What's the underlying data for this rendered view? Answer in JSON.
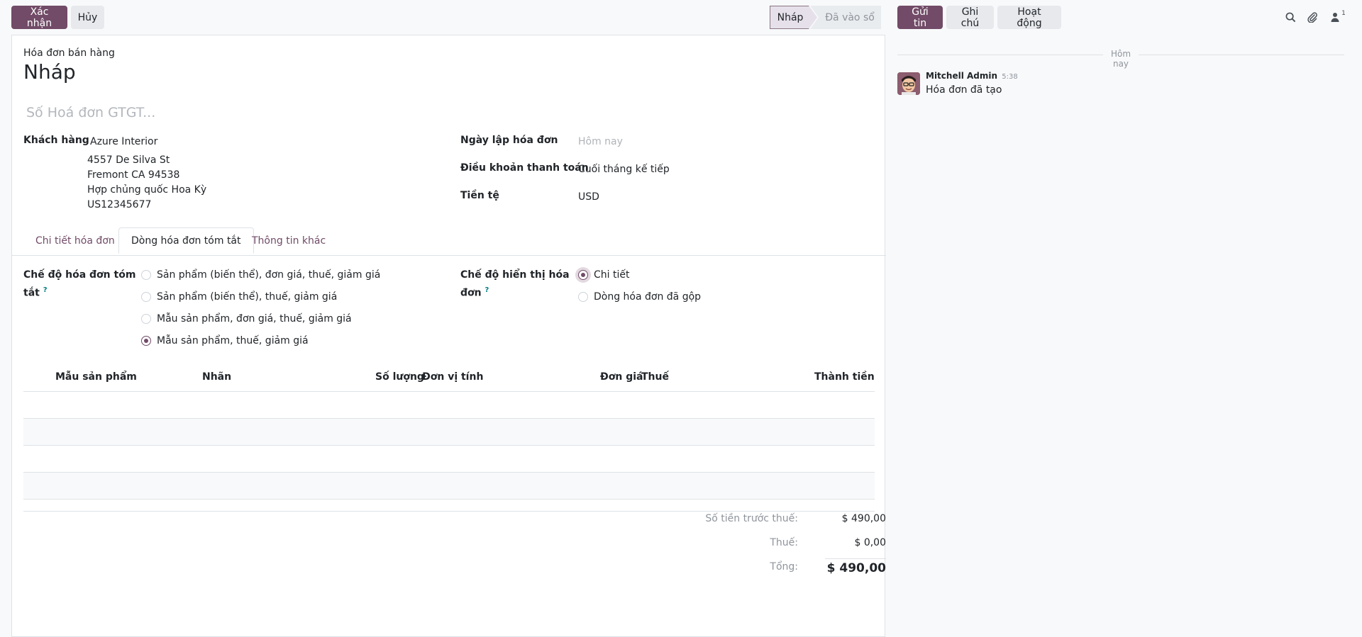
{
  "toolbar": {
    "confirm_label": "Xác nhận",
    "cancel_label": "Hủy"
  },
  "status": {
    "stages": [
      "Nháp",
      "Đã vào sổ"
    ],
    "active": "Nháp"
  },
  "form": {
    "doc_type": "Hóa đơn bán hàng",
    "title": "Nháp",
    "vat_placeholder": "Số Hoá đơn GTGT...",
    "customer_label": "Khách hàng",
    "customer_name": "Azure Interior",
    "address": [
      "4557 De Silva St",
      "Fremont CA 94538",
      "Hợp chủng quốc Hoa Kỳ",
      "US12345677"
    ],
    "invoice_date_label": "Ngày lập hóa đơn",
    "invoice_date_placeholder": "Hôm nay",
    "payment_terms_label": "Điều khoản thanh toán",
    "payment_terms_value": "Cuối tháng kế tiếp",
    "currency_label": "Tiền tệ",
    "currency_value": "USD"
  },
  "tabs": [
    {
      "label": "Chi tiết hóa đơn",
      "active": false
    },
    {
      "label": "Dòng hóa đơn tóm tắt",
      "active": true
    },
    {
      "label": "Thông tin khác",
      "active": false
    }
  ],
  "summary_mode": {
    "label_line1": "Chế độ hóa đơn tóm",
    "label_line2": "tắt",
    "help": "?",
    "options": [
      {
        "label": "Sản phẩm (biến thể), đơn giá, thuế, giảm giá",
        "checked": false
      },
      {
        "label": "Sản phẩm (biến thể), thuế, giảm giá",
        "checked": false
      },
      {
        "label": "Mẫu sản phẩm, đơn giá, thuế, giảm giá",
        "checked": false
      },
      {
        "label": "Mẫu sản phẩm, thuế, giảm giá",
        "checked": true
      }
    ]
  },
  "display_mode": {
    "label_line1": "Chế độ hiển thị hóa",
    "label_line2": "đơn",
    "help": "?",
    "options": [
      {
        "label": "Chi tiết",
        "checked": true
      },
      {
        "label": "Dòng hóa đơn đã gộp",
        "checked": false
      }
    ]
  },
  "table": {
    "columns": [
      "Mẫu sản phẩm",
      "Nhãn",
      "Số lượng",
      "Đơn vị tính",
      "Đơn giá",
      "Thuế",
      "Thành tiền"
    ],
    "rows": []
  },
  "totals": {
    "untaxed_label": "Số tiền trước thuế:",
    "untaxed_value": "$ 490,00",
    "tax_label": "Thuế:",
    "tax_value": "$ 0,00",
    "total_label": "Tổng:",
    "total_value": "$ 490,00"
  },
  "chatter": {
    "send_label": "Gửi tin",
    "note_label": "Ghi chú",
    "activity_label": "Hoạt động",
    "follower_count": "1",
    "date_separator": "Hôm nay",
    "message": {
      "author": "Mitchell Admin",
      "time": "5:38",
      "body": "Hóa đơn đã tạo"
    }
  },
  "colors": {
    "brand": "#714b67",
    "secondary_button": "#e7e9ed",
    "link": "#714b67"
  },
  "icons": [
    "search-icon",
    "paperclip-icon",
    "user-icon",
    "avatar"
  ]
}
